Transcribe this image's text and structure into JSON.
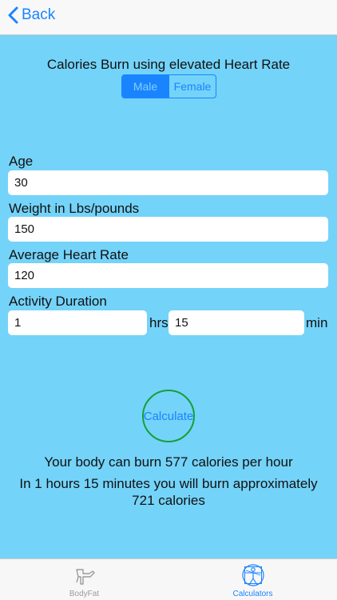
{
  "navbar": {
    "back_label": "Back"
  },
  "header": {
    "title": "Calories Burn using elevated Heart Rate",
    "gender": {
      "options": [
        "Male",
        "Female"
      ],
      "selected": "Male"
    }
  },
  "form": {
    "age": {
      "label": "Age",
      "value": "30"
    },
    "weight": {
      "label": "Weight in Lbs/pounds",
      "value": "150"
    },
    "heart_rate": {
      "label": "Average Heart Rate",
      "value": "120"
    },
    "duration": {
      "label": "Activity Duration",
      "hours": "1",
      "hours_unit": "hrs",
      "minutes": "15",
      "minutes_unit": "min"
    }
  },
  "calculate_label": "Calculate",
  "results": {
    "line1": "Your body can burn 577 calories per hour",
    "line2": "In 1 hours 15 minutes you will burn approximately",
    "line3": "721 calories"
  },
  "tabbar": {
    "tabs": [
      {
        "label": "BodyFat",
        "icon": "bodyfat-caliper-icon",
        "active": false
      },
      {
        "label": "Calculators",
        "icon": "vitruvian-man-icon",
        "active": true
      }
    ]
  },
  "colors": {
    "background": "#74d3f9",
    "accent": "#1a84ff",
    "calc_ring": "#169e3a"
  }
}
